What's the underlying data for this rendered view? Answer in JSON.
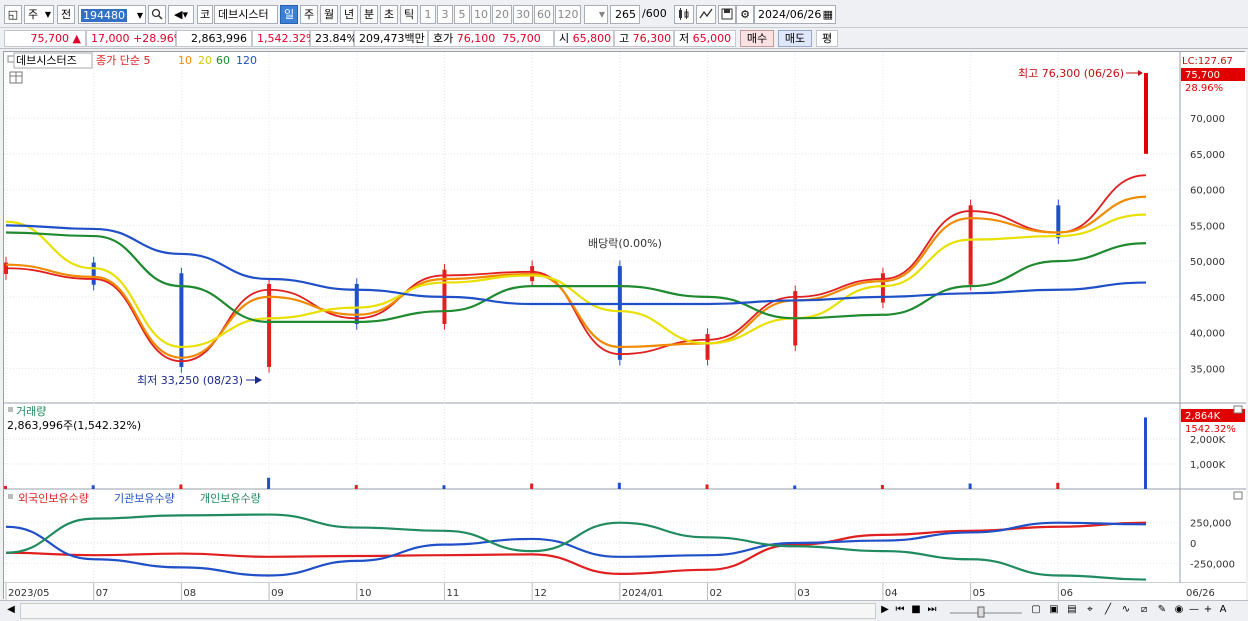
{
  "toolbar": {
    "market_kind": "주",
    "prev_label": "전",
    "code": "194480",
    "market_tag": "코",
    "stock_name": "데브시스터",
    "periods": [
      "일",
      "주",
      "월",
      "년",
      "분",
      "초",
      "틱"
    ],
    "active_period": "일",
    "intervals": [
      "1",
      "3",
      "5",
      "10",
      "20",
      "30",
      "60",
      "120"
    ],
    "count": "265",
    "count_max": "/600",
    "date": "2024/06/26"
  },
  "quote": {
    "price": "75,700",
    "change_arrow": "▲",
    "change": "17,000",
    "change_pct": "+28.96%",
    "volume": "2,863,996",
    "volume_ratio": "1,542.32%",
    "turnover": "23.84%",
    "amount": "209,473백만",
    "ask_label": "호가",
    "ask": "76,100",
    "bid": "75,700",
    "open_label": "시",
    "open": "65,800",
    "high_label": "고",
    "high": "76,300",
    "low_label": "저",
    "low": "65,000",
    "buy_label": "매수",
    "sell_label": "매도",
    "eval_label": "평"
  },
  "price_panel": {
    "stock_tab": "데브시스터즈",
    "ma_legend": [
      {
        "label": "종가 단순 5",
        "color": "#e02020"
      },
      {
        "label": "10",
        "color": "#f08a00"
      },
      {
        "label": "20",
        "color": "#e8e000"
      },
      {
        "label": "60",
        "color": "#208a30"
      },
      {
        "label": "120",
        "color": "#2050c8"
      }
    ],
    "lc_label": "LC:127.67",
    "price_tag": "75,700",
    "pct_tag": "28.96%",
    "high_note": "최고 76,300 (06/26)",
    "low_note": "최저 33,250 (08/23)",
    "dividend_note": "배당락(0.00%)",
    "y_ticks": [
      "70,000",
      "65,000",
      "60,000",
      "55,000",
      "50,000",
      "45,000",
      "40,000",
      "35,000"
    ]
  },
  "volume_panel": {
    "title": "거래량",
    "info": "2,863,996주(1,542.32%)",
    "tag": "2,864K",
    "pct_tag": "1542.32%",
    "y_ticks": [
      "2,000K",
      "1,000K"
    ]
  },
  "holdings_panel": {
    "legend": [
      {
        "label": "외국인보유수량",
        "color": "#e02020"
      },
      {
        "label": "기관보유수량",
        "color": "#2050c8"
      },
      {
        "label": "개인보유수량",
        "color": "#208a60"
      }
    ],
    "y_ticks": [
      "250,000",
      "0",
      "-250,000"
    ]
  },
  "x_axis": [
    "2023/05",
    "07",
    "08",
    "09",
    "10",
    "11",
    "12",
    "2024/01",
    "02",
    "03",
    "04",
    "05",
    "06",
    "06/26"
  ],
  "chart_data": [
    {
      "type": "line",
      "title": "데브시스터즈",
      "x": [
        "2023/05",
        "07",
        "08",
        "09",
        "10",
        "11",
        "12",
        "2024/01",
        "02",
        "03",
        "04",
        "05",
        "06",
        "06/26"
      ],
      "series": [
        {
          "name": "종가 단순 5",
          "values": [
            49000,
            47500,
            36000,
            46000,
            42000,
            48000,
            48500,
            37000,
            39000,
            45000,
            47500,
            57000,
            54000,
            62000
          ]
        },
        {
          "name": "10",
          "values": [
            49500,
            47800,
            36500,
            45000,
            42500,
            47500,
            48200,
            38000,
            38500,
            44500,
            47200,
            56000,
            54000,
            59000
          ]
        },
        {
          "name": "20",
          "values": [
            55500,
            49000,
            38000,
            42000,
            43500,
            47000,
            48000,
            43000,
            38500,
            42000,
            46500,
            53000,
            53500,
            56500
          ]
        },
        {
          "name": "60",
          "values": [
            54000,
            53500,
            46500,
            41500,
            41500,
            43000,
            46500,
            46500,
            45000,
            42000,
            42500,
            46500,
            50000,
            52500
          ]
        },
        {
          "name": "120",
          "values": [
            55000,
            54500,
            51000,
            47500,
            46000,
            45000,
            44000,
            44000,
            44000,
            44500,
            45000,
            45500,
            46000,
            47000
          ]
        }
      ],
      "ylim": [
        31000,
        77000
      ],
      "annotations": {
        "high": 76300,
        "low": 33250,
        "last": 75700
      }
    },
    {
      "type": "bar",
      "title": "거래량",
      "x": [
        "2023/05",
        "07",
        "08",
        "09",
        "10",
        "11",
        "12",
        "2024/01",
        "02",
        "03",
        "04",
        "05",
        "06",
        "06/26"
      ],
      "values": [
        120000,
        150000,
        180000,
        450000,
        160000,
        150000,
        220000,
        250000,
        180000,
        140000,
        160000,
        220000,
        250000,
        2863996
      ],
      "ylim": [
        0,
        3000000
      ]
    },
    {
      "type": "line",
      "title": "보유수량",
      "x": [
        "2023/05",
        "07",
        "08",
        "09",
        "10",
        "11",
        "12",
        "2024/01",
        "02",
        "03",
        "04",
        "05",
        "06",
        "06/26"
      ],
      "series": [
        {
          "name": "외국인보유수량",
          "values": [
            -120000,
            -150000,
            -130000,
            -170000,
            -160000,
            -150000,
            -140000,
            -380000,
            -330000,
            -20000,
            100000,
            150000,
            200000,
            250000
          ]
        },
        {
          "name": "기관보유수량",
          "values": [
            200000,
            -200000,
            -300000,
            -400000,
            -220000,
            -20000,
            50000,
            -170000,
            -150000,
            0,
            30000,
            130000,
            250000,
            230000
          ]
        },
        {
          "name": "개인보유수량",
          "values": [
            -120000,
            300000,
            340000,
            350000,
            190000,
            150000,
            -100000,
            250000,
            70000,
            -40000,
            -100000,
            -200000,
            -400000,
            -450000
          ]
        }
      ],
      "ylim": [
        -480000,
        480000
      ]
    }
  ]
}
